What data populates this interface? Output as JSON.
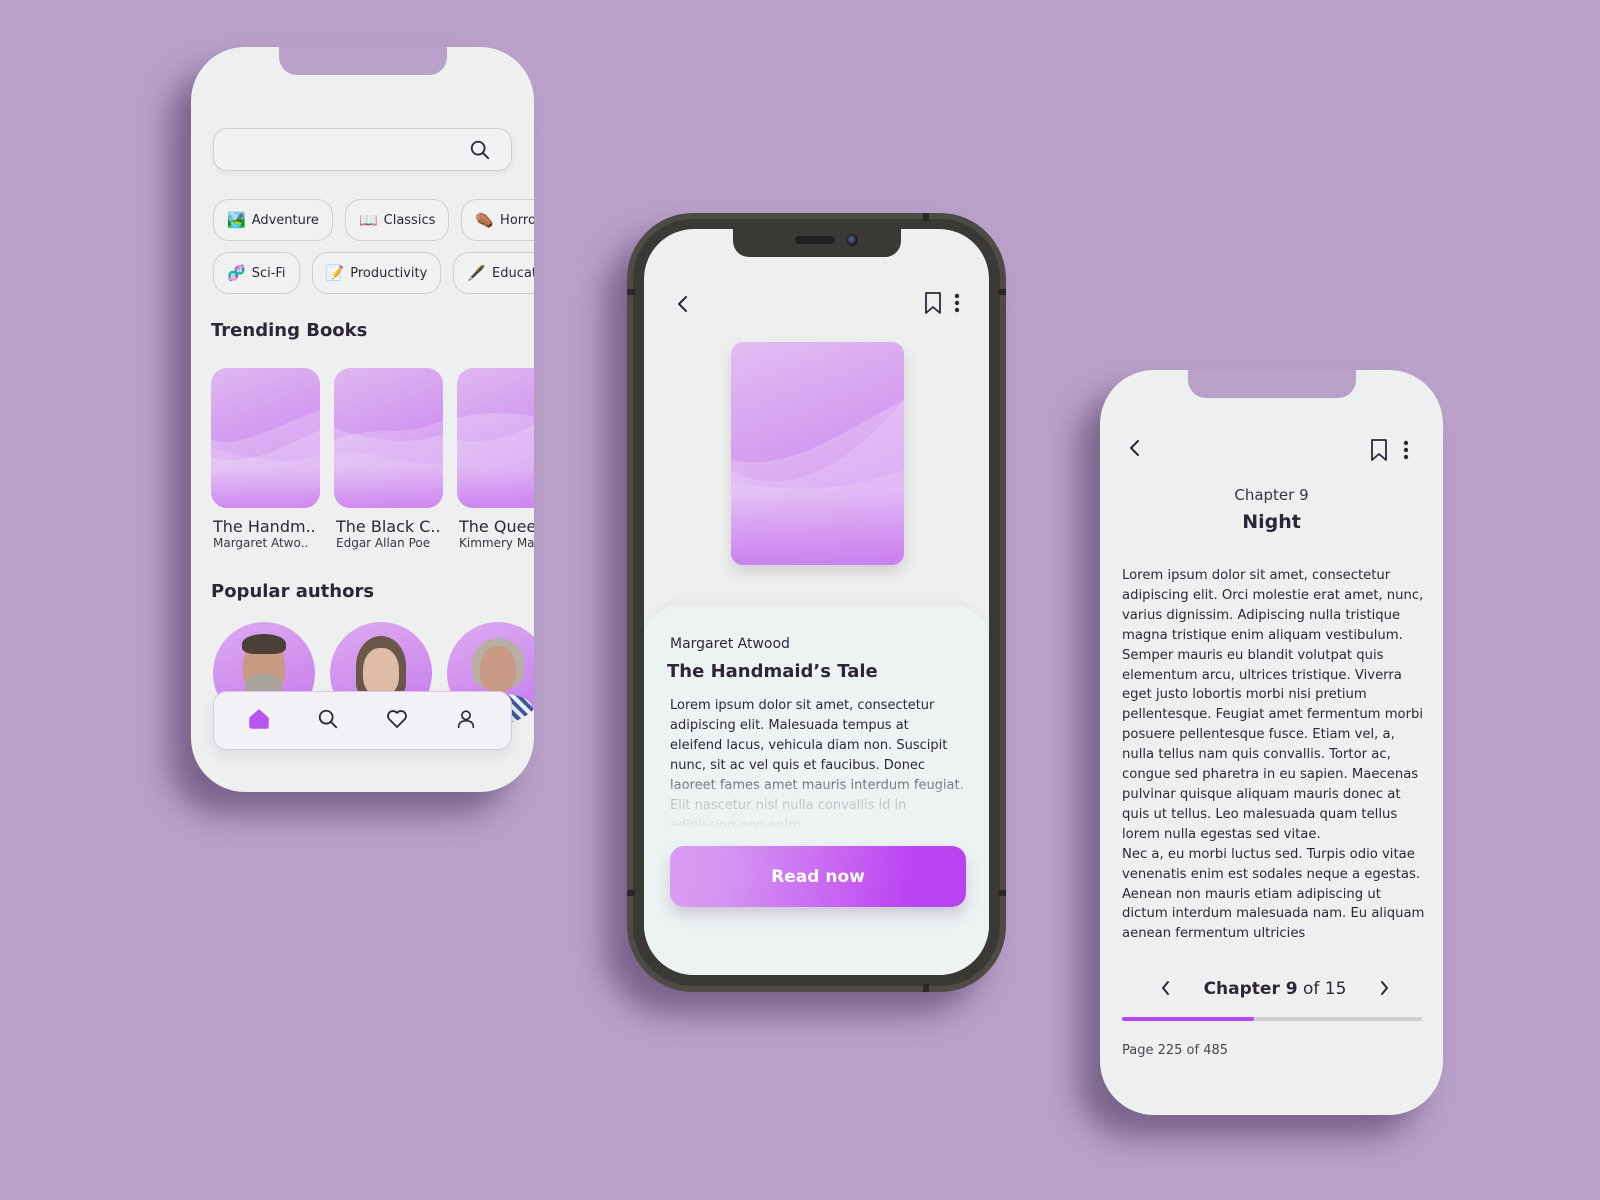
{
  "theme": {
    "background": "#b9a1c9",
    "accent": "#b845f0",
    "accent_light": "#d99cf3",
    "screen": "#eef0ef",
    "text": "#2e2638"
  },
  "home": {
    "search": {
      "placeholder": "",
      "value": "",
      "icon": "search-icon"
    },
    "genres_row1": [
      {
        "emoji": "🏞️",
        "label": "Adventure"
      },
      {
        "emoji": "📖",
        "label": "Classics"
      },
      {
        "emoji": "⚰️",
        "label": "Horror"
      }
    ],
    "genres_row2": [
      {
        "emoji": "🧬",
        "label": "Sci-Fi"
      },
      {
        "emoji": "📝",
        "label": "Productivity"
      },
      {
        "emoji": "🖋️",
        "label": "Education"
      }
    ],
    "trending_title": "Trending Books",
    "trending_books": [
      {
        "title": "The Handm..",
        "author": "Margaret Atwo.."
      },
      {
        "title": "The Black C..",
        "author": "Edgar Allan Poe"
      },
      {
        "title": "The Queen",
        "author": "Kimmery Martin"
      }
    ],
    "authors_title": "Popular authors",
    "authors": [
      {
        "name": "author-1"
      },
      {
        "name": "author-2"
      },
      {
        "name": "author-3"
      }
    ],
    "nav": [
      {
        "icon": "home-icon",
        "active": true
      },
      {
        "icon": "search-icon",
        "active": false
      },
      {
        "icon": "heart-icon",
        "active": false
      },
      {
        "icon": "user-icon",
        "active": false
      }
    ]
  },
  "detail": {
    "author": "Margaret Atwood",
    "title": "The Handmaid’s Tale",
    "description": "Lorem ipsum dolor sit amet, consectetur adipiscing elit. Malesuada tempus at eleifend lacus, vehicula diam non. Suscipit nunc, sit ac vel quis et faucibus. Donec laoreet fames amet mauris interdum feugiat. Elit nascetur nisl nulla convallis id in adipiscing non enim.",
    "read_button": "Read now"
  },
  "reader": {
    "chapter_label": "Chapter 9",
    "chapter_name": "Night",
    "paragraphs": [
      "Lorem ipsum dolor sit amet, consectetur adipiscing elit. Orci molestie erat amet, nunc, varius dignissim. Adipiscing nulla tristique magna tristique enim aliquam vestibulum. Semper mauris eu blandit volutpat quis elementum arcu, ultrices tristique. Viverra eget justo lobortis morbi nisi pretium pellentesque. Feugiat amet fermentum morbi posuere pellentesque fusce. Etiam vel, a, nulla tellus nam quis convallis. Tortor ac, congue sed pharetra in eu sapien. Maecenas pulvinar quisque aliquam mauris donec at quis ut tellus. Leo malesuada quam tellus lorem nulla egestas sed vitae.",
      "Nec a, eu morbi luctus sed. Turpis odio vitae venenatis enim est sodales neque a egestas. Aenean non mauris etiam adipiscing ut dictum interdum malesuada nam. Eu aliquam aenean fermentum ultricies"
    ],
    "chapter_nav": {
      "prefix": "Chapter 9",
      "suffix": " of 15",
      "current": 9,
      "total": 15
    },
    "progress_percent": 44,
    "page_info": "Page 225 of 485"
  }
}
